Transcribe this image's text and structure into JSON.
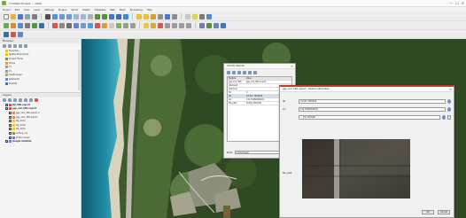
{
  "app": {
    "title": "*Untitled Project — QGIS",
    "window_controls": [
      "—",
      "☐",
      "✕"
    ]
  },
  "menu": [
    "Project",
    "Edit",
    "View",
    "Layer",
    "Settings",
    "Plugins",
    "Vector",
    "Raster",
    "Database",
    "Web",
    "Mesh",
    "Processing",
    "Help"
  ],
  "browser": {
    "title": "Browser",
    "items": [
      {
        "label": "Favorites",
        "color": "#e8c234",
        "level": 1
      },
      {
        "label": "Spatial Bookmarks",
        "color": "#e8c234",
        "level": 1
      },
      {
        "label": "Project Home",
        "color": "#6b9b3a",
        "level": 1
      },
      {
        "label": "Home",
        "color": "#d9a441",
        "level": 1
      },
      {
        "label": "C:\\",
        "color": "#9a9a9a",
        "level": 1
      },
      {
        "label": "D:\\",
        "color": "#9a9a9a",
        "level": 1
      },
      {
        "label": "GeoPackage",
        "color": "#c9a227",
        "level": 1
      },
      {
        "label": "SpatiaLite",
        "color": "#5e87c9",
        "level": 1
      },
      {
        "label": "PostGIS",
        "color": "#3f6fb2",
        "level": 1
      }
    ]
  },
  "layers": {
    "title": "Layers",
    "items": [
      {
        "label": "DJI_VRS export",
        "checked": true,
        "color": "#e04b4b",
        "level": 1
      },
      {
        "label": "ggs_xml_VRS export",
        "checked": true,
        "color": "#e04b4b",
        "level": 1
      },
      {
        "label": "ggs_xml_VRS export 2",
        "checked": true,
        "color": "#e08a3c",
        "level": 2
      },
      {
        "label": "ggs_xml_VRS export",
        "checked": true,
        "color": "#e08a3c",
        "level": 2
      },
      {
        "label": "DJI_0104",
        "checked": true,
        "color": "#f0c23c",
        "level": 2
      },
      {
        "label": "DJI_0218",
        "checked": true,
        "color": "#f0c23c",
        "level": 2
      },
      {
        "label": "DJI_0220",
        "checked": true,
        "color": "#f0c23c",
        "level": 2
      },
      {
        "label": "outline_vrs",
        "checked": true,
        "color": "#6b9b3a",
        "level": 2
      },
      {
        "label": "Ortho mosaic",
        "checked": true,
        "color": "#8f6fb8",
        "level": 2
      },
      {
        "label": "Google Satellite",
        "checked": true,
        "color": "#5e87c9",
        "level": 1
      }
    ]
  },
  "feature_dialog": {
    "title": "Identify Results",
    "columns": [
      "Feature",
      "Value"
    ],
    "rows": [
      {
        "c1": "ggs_xml_VRS",
        "c2": "ggs_xml_VRS export"
      },
      {
        "c1": "(Derived)",
        "c2": ""
      },
      {
        "c1": "(Actions)",
        "c2": ""
      },
      {
        "c1": "fid",
        "c2": "4"
      },
      {
        "c1": "lat",
        "c2": "34.507 7055995"
      },
      {
        "c1": "lon",
        "c2": "132.75680300021"
      },
      {
        "c1": "file_path",
        "c2": "D:/DJI_0218.JPG"
      }
    ],
    "selected_row": 4,
    "mode_label": "Mode",
    "mode_value": "Current layer"
  },
  "attr_dialog": {
    "title": "ggs_xml_VRS export - Feature Attributes",
    "fields": [
      {
        "label": "lat",
        "value": "34.507 7055995"
      },
      {
        "label": "lon",
        "value": "132.75680300021"
      },
      {
        "label": "file_path",
        "value": "..._DJI_0218.JPG"
      }
    ],
    "photo_label": "file_path",
    "ok_label": "OK",
    "cancel_label": "Cancel"
  },
  "colors": {
    "accent": "#c23a2e",
    "selection": "#cfe0f6"
  }
}
